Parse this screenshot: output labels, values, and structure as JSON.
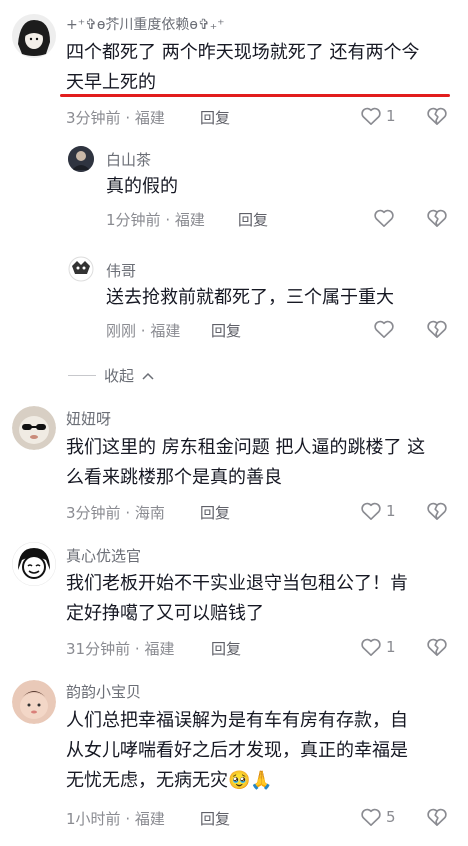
{
  "comments": [
    {
      "username": "+⁺✞ɵ芥川重度依赖ɵ✞₊⁺",
      "text_line1": "四个都死了 两个昨天现场就死了 还有两个今",
      "text_line2": "天早上死的",
      "time": "3分钟前",
      "location": "福建",
      "reply": "回复",
      "likes": "1"
    },
    {
      "username": "白山茶",
      "text": "真的假的",
      "time": "1分钟前",
      "location": "福建",
      "reply": "回复"
    },
    {
      "username": "伟哥",
      "text": "送去抢救前就都死了，三个属于重大",
      "time": "刚刚",
      "location": "福建",
      "reply": "回复"
    },
    {
      "username": "妞妞呀",
      "text_line1": "我们这里的 房东租金问题 把人逼的跳楼了 这",
      "text_line2": "么看来跳楼那个是真的善良",
      "time": "3分钟前",
      "location": "海南",
      "reply": "回复",
      "likes": "1"
    },
    {
      "username": "真心优选官",
      "text_line1": "我们老板开始不干实业退守当包租公了！肯",
      "text_line2": "定好挣噶了又可以赔钱了",
      "time": "31分钟前",
      "location": "福建",
      "reply": "回复",
      "likes": "1"
    },
    {
      "username": "韵韵小宝贝",
      "text_line1": "人们总把幸福误解为是有车有房有存款，自",
      "text_line2": "从女儿哮喘看好之后才发现，真正的幸福是",
      "text_line3": "无忧无虑，无病无灾🥹🙏",
      "time": "1小时前",
      "location": "福建",
      "reply": "回复",
      "likes": "5"
    }
  ],
  "collapse_label": "收起",
  "meta_separator": "·",
  "colors": {
    "text": "#161823",
    "meta": "#8a8b91",
    "accent_red": "#e21d1d"
  }
}
